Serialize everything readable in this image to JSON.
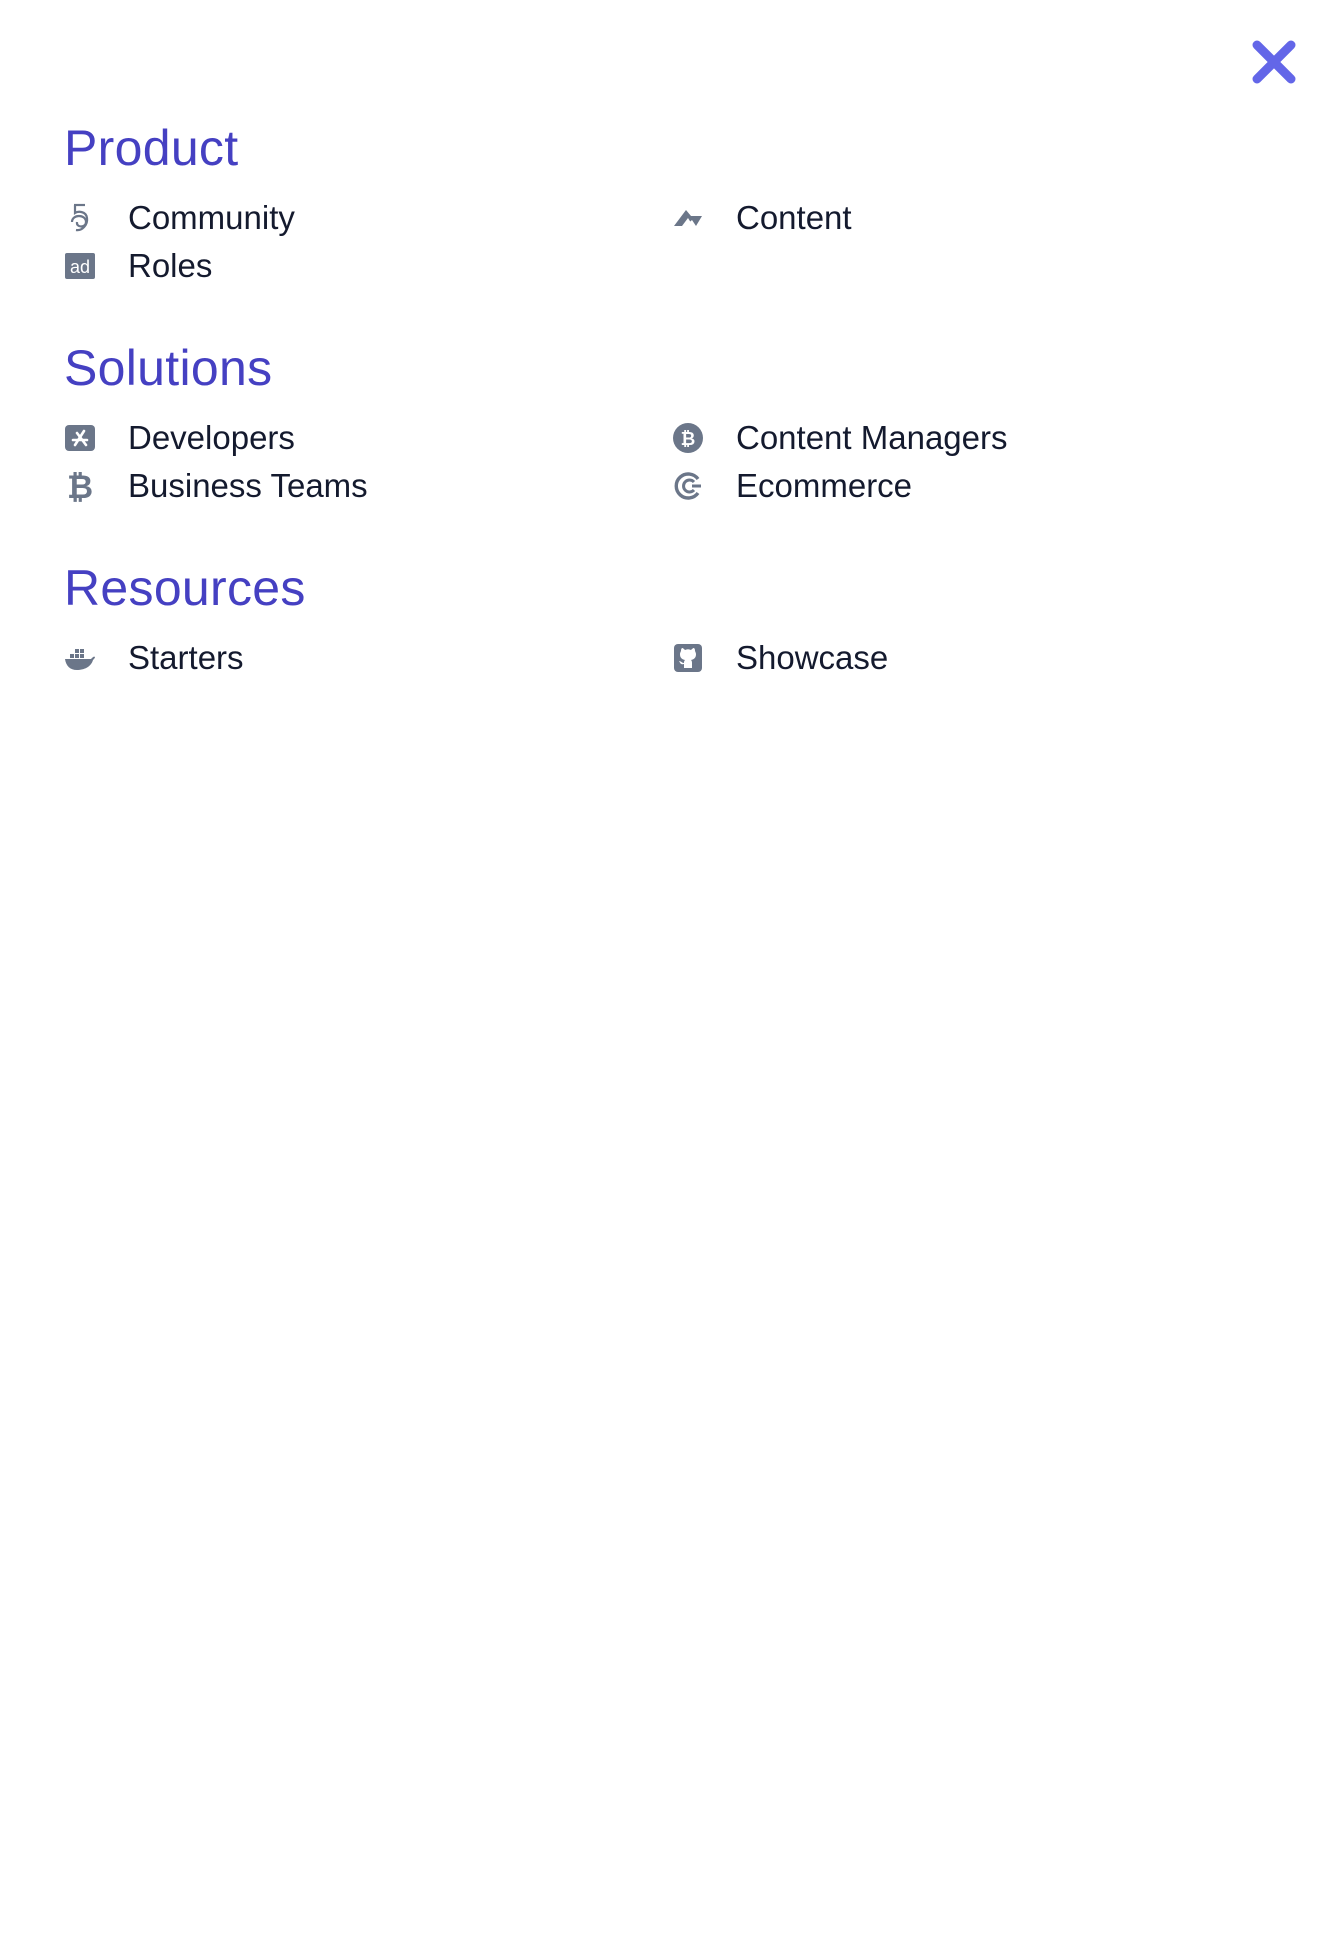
{
  "colors": {
    "heading": "#4540c2",
    "close_icon": "#6366e8",
    "item_text": "#141a2e",
    "icon": "#6b7689"
  },
  "close": {
    "icon": "close-icon"
  },
  "sections": [
    {
      "title": "Product",
      "items": [
        {
          "label": "Community",
          "icon": "fiverr-icon"
        },
        {
          "label": "Content",
          "icon": "kickstarter-k-icon"
        },
        {
          "label": "Roles",
          "icon": "ad-icon"
        }
      ]
    },
    {
      "title": "Solutions",
      "items": [
        {
          "label": "Developers",
          "icon": "app-store-icon"
        },
        {
          "label": "Content Managers",
          "icon": "bitcoin-circle-icon"
        },
        {
          "label": "Business Teams",
          "icon": "bitcoin-icon"
        },
        {
          "label": "Ecommerce",
          "icon": "c-icon"
        }
      ]
    },
    {
      "title": "Resources",
      "items": [
        {
          "label": "Starters",
          "icon": "docker-icon"
        },
        {
          "label": "Showcase",
          "icon": "github-square-icon"
        }
      ]
    }
  ]
}
